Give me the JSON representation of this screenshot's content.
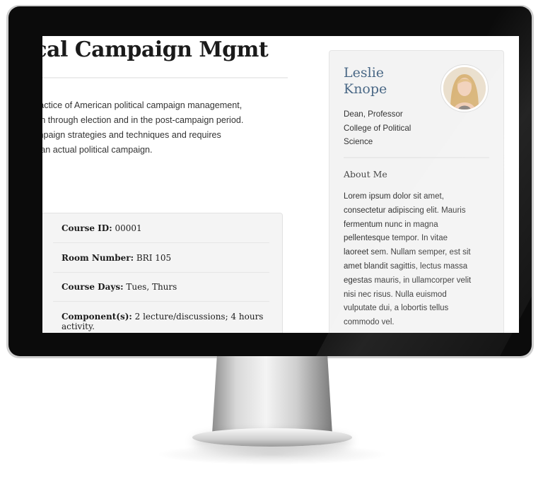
{
  "page": {
    "title": "tical Campaign Mgmt",
    "description_lines": [
      "practice of American political campaign management,",
      "tion through election and in the post-campaign period.",
      "ampaign strategies and techniques and requires",
      " in an actual political campaign."
    ]
  },
  "course_info": [
    {
      "label": "Course ID:",
      "value": " 00001"
    },
    {
      "label": "Room Number:",
      "value": " BRI 105"
    },
    {
      "label": "Course Days:",
      "value": " Tues, Thurs"
    },
    {
      "label": "Component(s):",
      "value": " 2 lecture/discussions; 4 hours",
      "value_line2": "activity."
    }
  ],
  "professor": {
    "first_name": "Leslie",
    "last_name": "Knope",
    "title_lines": [
      "Dean, Professor",
      "College of Political",
      "Science"
    ],
    "avatar_icon": "person-photo"
  },
  "about": {
    "heading": "About Me",
    "lines": [
      "Lorem ipsum dolor sit amet,",
      "consectetur adipiscing elit. Mauris",
      "fermentum nunc in magna",
      "pellentesque tempor. In vitae",
      "laoreet sem. Nullam semper, est sit",
      "amet blandit sagittis, lectus massa",
      "egestas mauris, in ullamcorper velit",
      "nisi nec risus. Nulla euismod",
      "vulputate dui, a lobortis tellus",
      "commodo vel."
    ]
  },
  "colors": {
    "accent_name": "#4a6886",
    "bezel": "#0b0b0b",
    "card_bg": "#f4f4f4"
  }
}
